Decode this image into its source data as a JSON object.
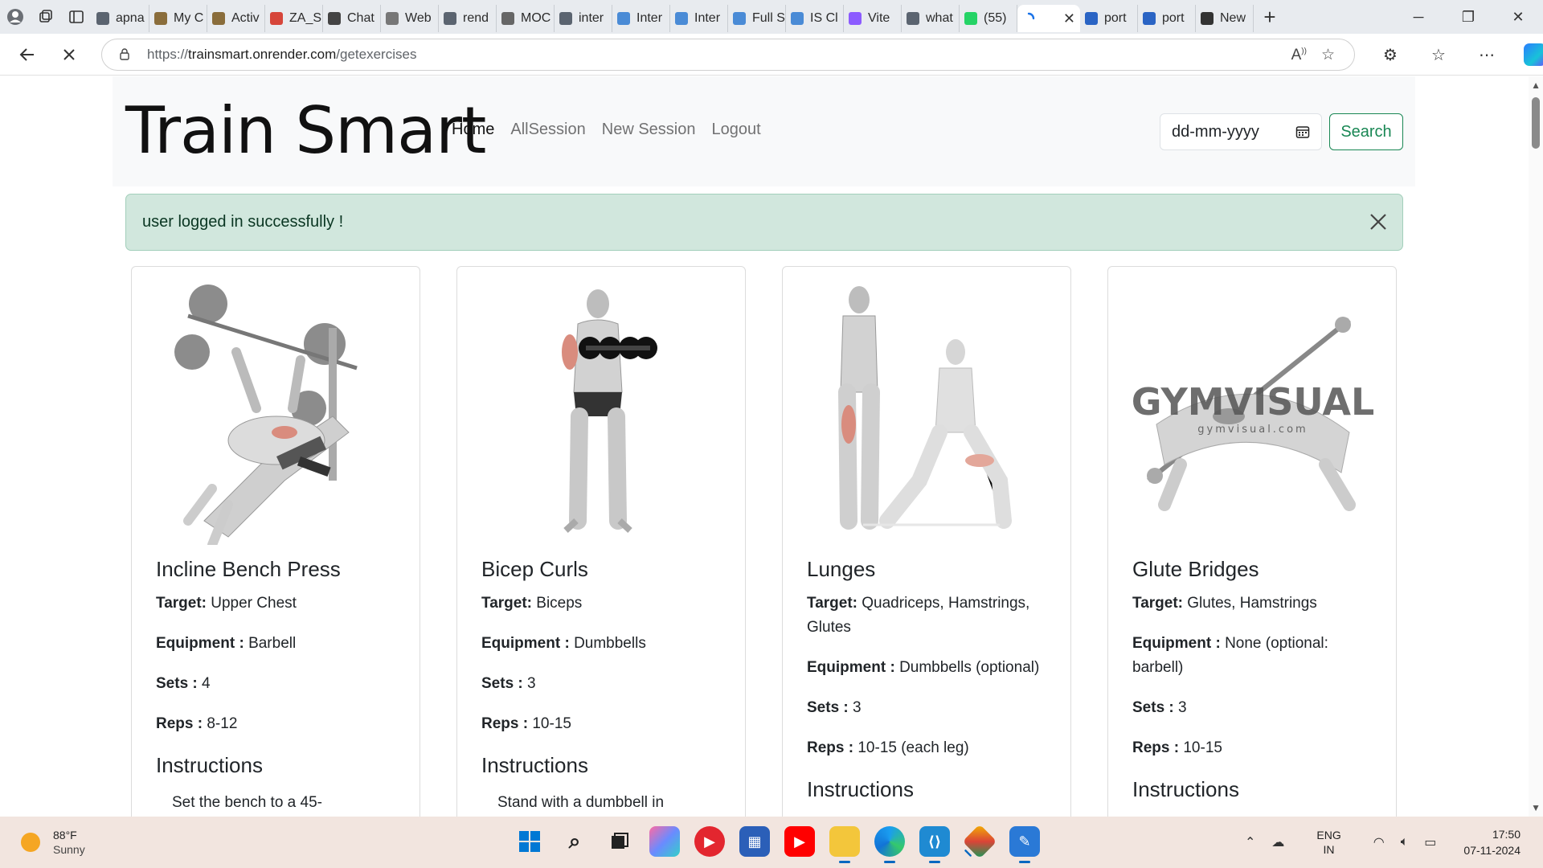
{
  "browser": {
    "tabs": [
      {
        "label": "apna",
        "icon": "search-icon",
        "color": "#5b6470"
      },
      {
        "label": "My C",
        "icon": "page-icon",
        "color": "#8a6d3b"
      },
      {
        "label": "Activ",
        "icon": "page-icon",
        "color": "#8a6d3b"
      },
      {
        "label": "ZA_S",
        "icon": "pdf-icon",
        "color": "#d6453a"
      },
      {
        "label": "Chat",
        "icon": "openai-icon",
        "color": "#444"
      },
      {
        "label": "Web",
        "icon": "openai-icon",
        "color": "#777"
      },
      {
        "label": "rend",
        "icon": "search-icon",
        "color": "#5b6470"
      },
      {
        "label": "MOC",
        "icon": "thumb-icon",
        "color": "#666"
      },
      {
        "label": "inter",
        "icon": "search-icon",
        "color": "#5b6470"
      },
      {
        "label": "Inter",
        "icon": "is-icon",
        "color": "#4a8bd6"
      },
      {
        "label": "Inter",
        "icon": "is-icon",
        "color": "#4a8bd6"
      },
      {
        "label": "Full S",
        "icon": "ist-icon",
        "color": "#4a8bd6"
      },
      {
        "label": "IS Cl",
        "icon": "is-icon",
        "color": "#4a8bd6"
      },
      {
        "label": "Vite",
        "icon": "vite-icon",
        "color": "#8c5bff"
      },
      {
        "label": "what",
        "icon": "search-icon",
        "color": "#5b6470"
      },
      {
        "label": "(55)",
        "icon": "whatsapp-icon",
        "color": "#25d366"
      }
    ],
    "active_tab": {
      "label": "",
      "icon": "loading-icon"
    },
    "after_tabs": [
      {
        "label": "port",
        "icon": "search-icon",
        "color": "#2a64c4"
      },
      {
        "label": "port",
        "icon": "search-icon",
        "color": "#2a64c4"
      },
      {
        "label": "New",
        "icon": "newtab-icon",
        "color": "#333"
      }
    ],
    "url_prefix": "https://",
    "url_host": "trainsmart.onrender.com",
    "url_path": "/getexercises"
  },
  "page": {
    "brand": "Train Smart",
    "nav": {
      "home": "Home",
      "all_session": "AllSession",
      "new_session": "New Session",
      "logout": "Logout"
    },
    "date_placeholder": "dd-mm-yyyy",
    "search_label": "Search",
    "alert_text": "user logged in successfully !",
    "labels": {
      "target": "Target:",
      "equipment": "Equipment :",
      "sets": "Sets :",
      "reps": "Reps :",
      "instructions": "Instructions"
    },
    "exercises": [
      {
        "name": "Incline Bench Press",
        "target": "Upper Chest",
        "equipment": "Barbell",
        "sets": "4",
        "reps": "8-12",
        "instruction_start": "Set the bench to a 45-"
      },
      {
        "name": "Bicep Curls",
        "target": "Biceps",
        "equipment": "Dumbbells",
        "sets": "3",
        "reps": "10-15",
        "instruction_start": "Stand with a dumbbell in"
      },
      {
        "name": "Lunges",
        "target": "Quadriceps, Hamstrings, Glutes",
        "equipment": "Dumbbells (optional)",
        "sets": "3",
        "reps": "10-15 (each leg)",
        "instruction_start": ""
      },
      {
        "name": "Glute Bridges",
        "target": "Glutes, Hamstrings",
        "equipment": "None (optional: barbell)",
        "sets": "3",
        "reps": "10-15",
        "instruction_start": ""
      }
    ],
    "watermark": "GYMVISUAL",
    "watermark_sub": "gymvisual.com"
  },
  "taskbar": {
    "temperature": "88°F",
    "condition": "Sunny",
    "lang_top": "ENG",
    "lang_bottom": "IN",
    "time": "17:50",
    "date": "07-11-2024"
  },
  "colors": {
    "success": "#198754",
    "alert_bg": "#d1e7dd",
    "navbar_bg": "#f8f9fa"
  }
}
